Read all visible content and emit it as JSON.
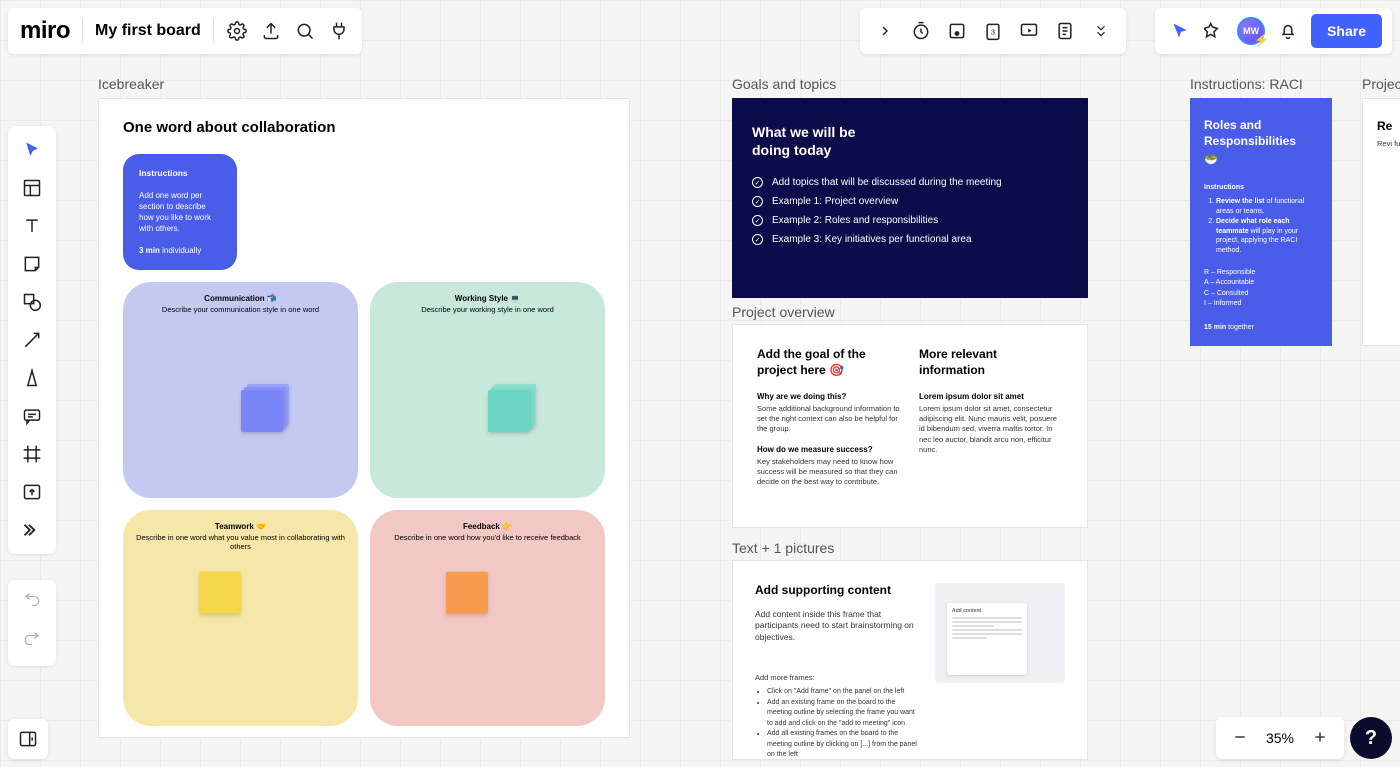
{
  "app": {
    "logo": "miro",
    "board_title": "My first board"
  },
  "share": {
    "label": "Share"
  },
  "avatar": {
    "initials": "MW"
  },
  "zoom": {
    "level": "35%"
  },
  "frames": {
    "icebreaker": {
      "label": "Icebreaker",
      "heading": "One word about collaboration",
      "instructions": {
        "title": "Instructions",
        "body": "Add one word per section to describe how you like to work with others.",
        "timing_bold": "3 min",
        "timing_rest": " individually"
      },
      "sections": [
        {
          "title": "Communication 📬",
          "desc": "Describe your communication style in one word",
          "bg": "#c5c9f2",
          "sticky": "#7a86f5"
        },
        {
          "title": "Working Style 💻",
          "desc": "Describe your working style in one word",
          "bg": "#c8e8dc",
          "sticky": "#6ed5c4"
        },
        {
          "title": "Teamwork 🤝",
          "desc": "Describe in one word what you value most in collaborating with others",
          "bg": "#f6e7a8",
          "sticky": "#f5d648"
        },
        {
          "title": "Feedback 👉",
          "desc": "Describe in one word how you'd like to receive feedback",
          "bg": "#f1c8c4",
          "sticky": "#f79b4f"
        }
      ]
    },
    "goals": {
      "label": "Goals and topics",
      "heading1": "What we will be",
      "heading2": "doing today",
      "items": [
        "Add topics that will be discussed during the meeting",
        "Example 1: Project overview",
        "Example 2: Roles and responsibilities",
        "Example 3: Key initiatives per functional area"
      ]
    },
    "project_overview": {
      "label": "Project overview",
      "left": {
        "heading": "Add the goal of the project here 🎯",
        "q1": "Why are we doing this?",
        "a1": "Some additional background information to set the right context can also be helpful for the group.",
        "q2": "How do we measure success?",
        "a2": "Key stakeholders may need to know how success will be measured so that they can decide on the best way to contribute."
      },
      "right": {
        "heading": "More relevant information",
        "q1": "Lorem ipsum dolor sit amet",
        "a1": "Lorem ipsum dolor sit amet, consectetur adipiscing elit. Nunc mauris velit, posuere id bibendum sed, viverra mattis tortor. In nec leo auctor, blandit arcu non, efficitur nunc."
      }
    },
    "textpic": {
      "label": "Text + 1 pictures",
      "heading": "Add supporting content",
      "body": "Add content inside this frame that participants need to start brainstorming on objectives.",
      "more": "Add more frames:",
      "bullets": [
        "Click on \"Add frame\" on the panel on the left",
        "Add an existing frame on the board to the meeting outline by selecting the frame you want to add and click on the \"add to meeting\" icon",
        "Add all existing frames on the board to the meeting outline by clicking on [...] from the panel on the left"
      ],
      "pic_title": "Add content"
    },
    "raci": {
      "label": "Instructions: RACI",
      "heading": "Roles and Responsibilities",
      "emoji": "🥗",
      "instr_h": "Instructions",
      "step1_bold": "Review the list",
      "step1_rest": " of functional areas or teams.",
      "step2_bold": "Decide what role each teammate",
      "step2_rest": " will play in your project, applying the RACI method.",
      "legend": {
        "r": "R – Responsible",
        "a": "A – Accountable",
        "c": "C – Consulted",
        "i": "I – Informed"
      },
      "timing_bold": "15 min",
      "timing_rest": " together"
    },
    "project2": {
      "label": "Project",
      "heading": "Re",
      "body": "Revi funi"
    }
  }
}
